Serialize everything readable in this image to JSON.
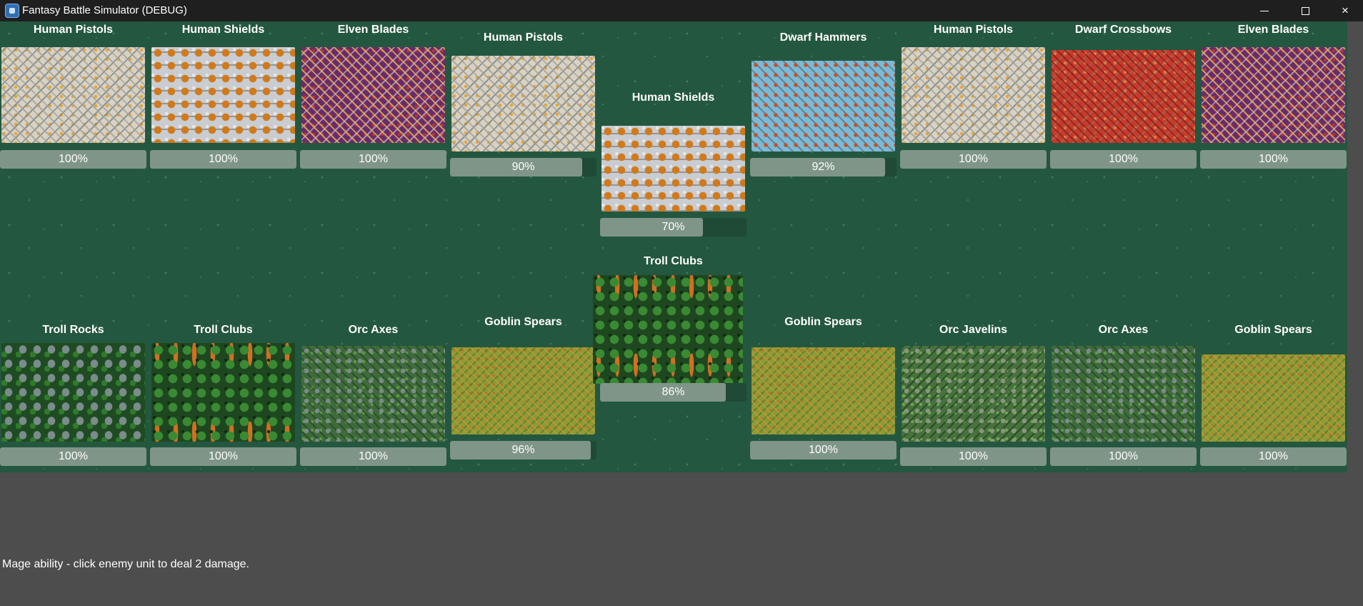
{
  "window": {
    "title": "Fantasy Battle Simulator (DEBUG)",
    "icon": "app-icon",
    "controls": {
      "minimize": "minimize-icon",
      "maximize": "maximize-icon",
      "close": "×"
    }
  },
  "colors": {
    "field": "#24573f",
    "background": "#4d4d4d",
    "hp_fill": "#7f9588",
    "hp_track": "#1f4a35",
    "titlebar": "#1f1f1f"
  },
  "player_units": [
    {
      "name": "Human Pistols",
      "hp_label": "100%",
      "hp": 100,
      "troop": "pistols"
    },
    {
      "name": "Human Shields",
      "hp_label": "100%",
      "hp": 100,
      "troop": "shields"
    },
    {
      "name": "Elven Blades",
      "hp_label": "100%",
      "hp": 100,
      "troop": "blades"
    },
    {
      "name": "Human Pistols",
      "hp_label": "90%",
      "hp": 90,
      "troop": "pistols"
    },
    {
      "name": "Human Shields",
      "hp_label": "70%",
      "hp": 70,
      "troop": "shields"
    },
    {
      "name": "Dwarf Hammers",
      "hp_label": "92%",
      "hp": 92,
      "troop": "hammers"
    },
    {
      "name": "Human Pistols",
      "hp_label": "100%",
      "hp": 100,
      "troop": "pistols"
    },
    {
      "name": "Dwarf Crossbows",
      "hp_label": "100%",
      "hp": 100,
      "troop": "crossbows"
    },
    {
      "name": "Elven Blades",
      "hp_label": "100%",
      "hp": 100,
      "troop": "blades"
    }
  ],
  "enemy_units": [
    {
      "name": "Troll Rocks",
      "hp_label": "100%",
      "hp": 100,
      "troop": "rocks"
    },
    {
      "name": "Troll Clubs",
      "hp_label": "100%",
      "hp": 100,
      "troop": "clubs"
    },
    {
      "name": "Orc Axes",
      "hp_label": "100%",
      "hp": 100,
      "troop": "axes"
    },
    {
      "name": "Goblin Spears",
      "hp_label": "96%",
      "hp": 96,
      "troop": "spears"
    },
    {
      "name": "Troll Clubs",
      "hp_label": "86%",
      "hp": 86,
      "troop": "clubs"
    },
    {
      "name": "Goblin Spears",
      "hp_label": "100%",
      "hp": 100,
      "troop": "spears"
    },
    {
      "name": "Orc Javelins",
      "hp_label": "100%",
      "hp": 100,
      "troop": "javelins"
    },
    {
      "name": "Orc Axes",
      "hp_label": "100%",
      "hp": 100,
      "troop": "axes"
    },
    {
      "name": "Goblin Spears",
      "hp_label": "100%",
      "hp": 100,
      "troop": "spears"
    }
  ],
  "status": {
    "message": "Mage ability - click enemy unit to deal 2 damage."
  }
}
